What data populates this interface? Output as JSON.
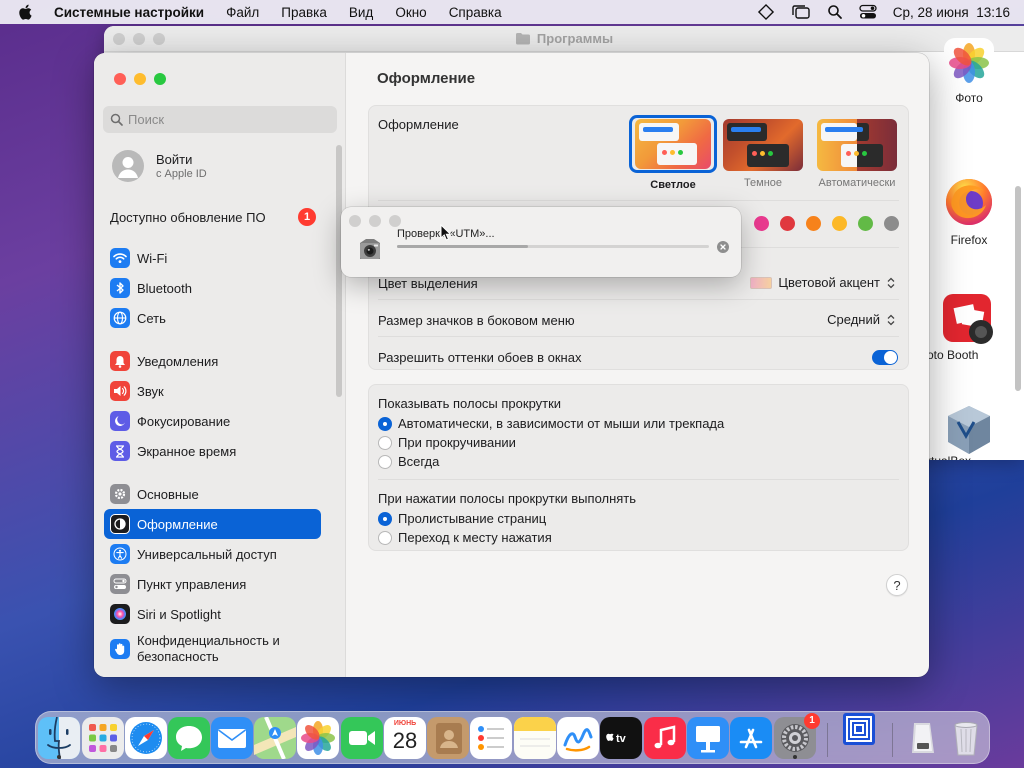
{
  "menubar": {
    "app_name": "Системные настройки",
    "items": [
      "Файл",
      "Правка",
      "Вид",
      "Окно",
      "Справка"
    ],
    "clock": "Ср, 28 июня  13:16"
  },
  "finder": {
    "title": "Программы",
    "apps": [
      {
        "label": "Фото",
        "icon": "photos-icon"
      },
      {
        "label": "Firefox",
        "icon": "firefox-icon"
      },
      {
        "label": "oto Booth",
        "icon": "photo-booth-icon"
      },
      {
        "label": "rtualBox",
        "icon": "virtualbox-icon"
      }
    ]
  },
  "sidebar": {
    "search_placeholder": "Поиск",
    "profile": {
      "name": "Войти",
      "sub": "с Apple ID"
    },
    "update": {
      "label": "Доступно обновление ПО",
      "badge": "1"
    },
    "items": [
      {
        "label": "Wi-Fi",
        "icon": "wifi-icon",
        "color": "#1d7cf2"
      },
      {
        "label": "Bluetooth",
        "icon": "bluetooth-icon",
        "color": "#1d7cf2"
      },
      {
        "label": "Сеть",
        "icon": "globe-icon",
        "color": "#1d7cf2"
      },
      {
        "label": "Уведомления",
        "icon": "bell-icon",
        "color": "#f0443a"
      },
      {
        "label": "Звук",
        "icon": "speaker-icon",
        "color": "#f0443a"
      },
      {
        "label": "Фокусирование",
        "icon": "moon-icon",
        "color": "#5e5ce6"
      },
      {
        "label": "Экранное время",
        "icon": "hourglass-icon",
        "color": "#5e5ce6"
      },
      {
        "label": "Основные",
        "icon": "gear-icon",
        "color": "#8e8e93"
      },
      {
        "label": "Оформление",
        "icon": "appearance-icon",
        "color": "#1c1c1e"
      },
      {
        "label": "Универсальный доступ",
        "icon": "accessibility-icon",
        "color": "#1d7cf2"
      },
      {
        "label": "Пункт управления",
        "icon": "control-center-icon",
        "color": "#8e8e93"
      },
      {
        "label": "Siri и Spotlight",
        "icon": "siri-icon",
        "color": "#1c1c1e"
      },
      {
        "label": "Конфиденциальность и безопасность",
        "icon": "hand-icon",
        "color": "#1d7cf2"
      }
    ]
  },
  "content": {
    "title": "Оформление",
    "appearance_label": "Оформление",
    "themes": [
      {
        "label": "Светлое",
        "selected": true
      },
      {
        "label": "Темное",
        "selected": false
      },
      {
        "label": "Автоматически",
        "selected": false
      }
    ],
    "accent_colors": [
      "#e93a8f",
      "#e0383e",
      "#f7821b",
      "#fcb827",
      "#62ba46",
      "#8c8c8c"
    ],
    "highlight_label": "Цвет выделения",
    "highlight_value": "Цветовой акцент",
    "icon_size_label": "Размер значков в боковом меню",
    "icon_size_value": "Средний",
    "wallpaper_tint_label": "Разрешить оттенки обоев в окнах",
    "wallpaper_tint_on": true,
    "scrollbars_label": "Показывать полосы прокрутки",
    "scrollbar_options": [
      {
        "label": "Автоматически, в зависимости от мыши или трекпада",
        "checked": true
      },
      {
        "label": "При прокручивании",
        "checked": false
      },
      {
        "label": "Всегда",
        "checked": false
      }
    ],
    "click_label": "При нажатии полосы прокрутки выполнять",
    "click_options": [
      {
        "label": "Пролистывание страниц",
        "checked": true
      },
      {
        "label": "Переход к месту нажатия",
        "checked": false
      }
    ],
    "help": "?"
  },
  "dialog": {
    "message": "Проверка «UTM»...",
    "progress": 0.42
  },
  "dock": {
    "calendar": {
      "month": "ИЮНЬ",
      "day": "28"
    },
    "settings_badge": "1",
    "apps": [
      "finder-icon",
      "launchpad-icon",
      "safari-icon",
      "messages-icon",
      "mail-icon",
      "maps-icon",
      "photos-icon",
      "facetime-icon",
      "calendar-icon",
      "contacts-icon",
      "reminders-icon",
      "notes-icon",
      "freeform-icon",
      "tv-icon",
      "music-icon",
      "keynote-icon",
      "app-store-icon",
      "system-settings-icon",
      "utm-icon",
      "disk-utility-icon",
      "trash-icon"
    ]
  }
}
